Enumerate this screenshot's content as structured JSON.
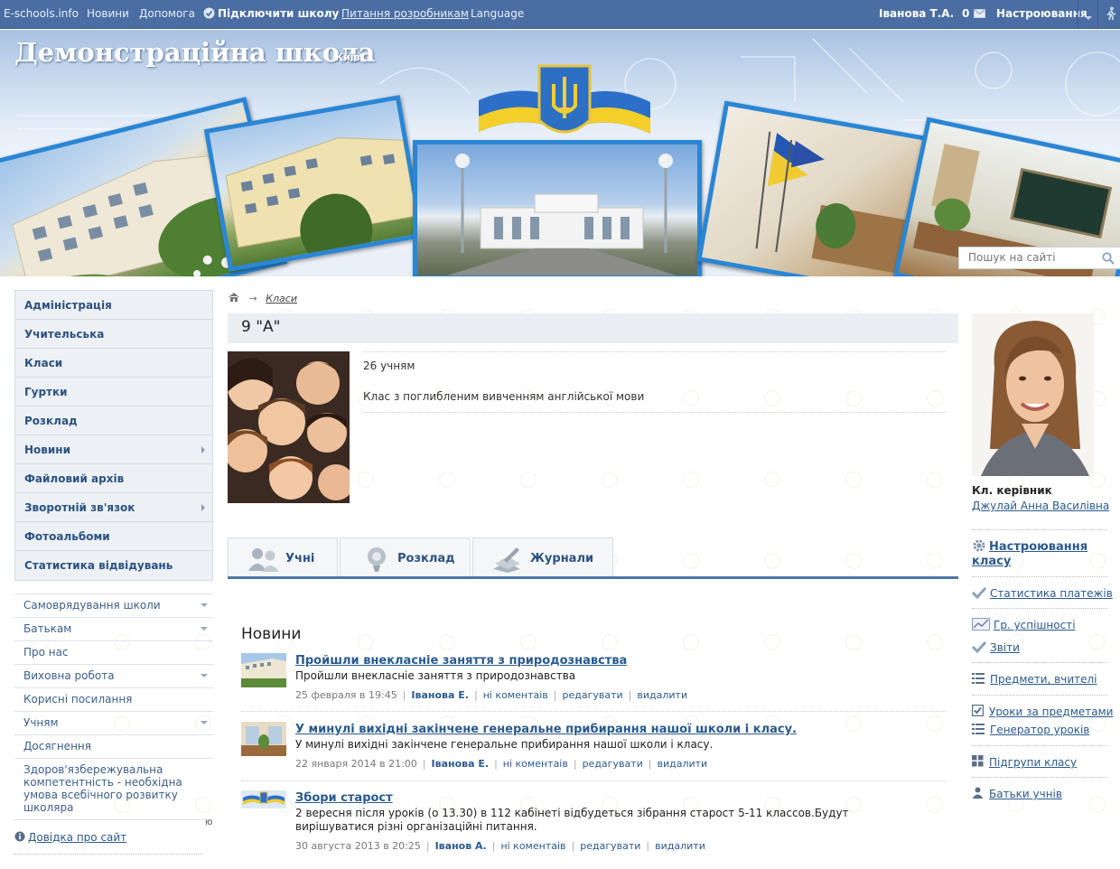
{
  "topbar": {
    "site": "E-schools.info",
    "news": "Новини",
    "help": "Допомога",
    "connect": "Підключити школу",
    "devs": "Питання розробникам",
    "language": "Language",
    "user": "Іванова Т.А.",
    "messages": "0",
    "settings": "Настроювання"
  },
  "banner": {
    "school": "Демонстраційна школа",
    "city": "Київ",
    "search_placeholder": "Пошук на сайті"
  },
  "main_menu": [
    {
      "label": "Адміністрація",
      "arrow": false
    },
    {
      "label": "Учительська",
      "arrow": false
    },
    {
      "label": "Класи",
      "arrow": false
    },
    {
      "label": "Гуртки",
      "arrow": false
    },
    {
      "label": "Розклад",
      "arrow": false
    },
    {
      "label": "Новини",
      "arrow": true
    },
    {
      "label": "Файловий архів",
      "arrow": false
    },
    {
      "label": "Зворотній зв'язок",
      "arrow": true
    },
    {
      "label": "Фотоальбоми",
      "arrow": false
    },
    {
      "label": "Статистика відвідувань",
      "arrow": false
    }
  ],
  "sub_menu": [
    {
      "label": "Самоврядування школи",
      "dropdown": true
    },
    {
      "label": "Батькам",
      "dropdown": true
    },
    {
      "label": "Про нас",
      "dropdown": false
    },
    {
      "label": "Виховна робота",
      "dropdown": true
    },
    {
      "label": "Корисні посилання",
      "dropdown": false
    },
    {
      "label": "Учням",
      "dropdown": true
    },
    {
      "label": "Досягнення",
      "dropdown": false
    },
    {
      "label": "Здоров'язбережувальна компетентність - необхідна умова всебічного розвитку школяра",
      "dropdown": false
    }
  ],
  "side_fragment": "ю",
  "help_link": "Довідка про сайт",
  "breadcrumb": {
    "current": "Класи"
  },
  "class": {
    "name": "9 \"А\"",
    "students": "26 учням",
    "description": "Клас з поглибленим вивченням англійської мови"
  },
  "tabs": [
    {
      "label": "Учні",
      "icon": "users-icon"
    },
    {
      "label": "Розклад",
      "icon": "bell-icon"
    },
    {
      "label": "Журнали",
      "icon": "journal-icon"
    }
  ],
  "news": {
    "heading": "Новини",
    "items": [
      {
        "title": "Пройшли внекласніе заняття з природознавства",
        "text": "Пройшли внекласніе заняття з природознавства",
        "date": "25 февраля в 19:45",
        "author": "Іванова Е.",
        "comments": "ні коментаів",
        "edit": "редагувати",
        "delete": "видалити"
      },
      {
        "title": "У минулі вихідні закінчене генеральне прибирання нашої школи і класу.",
        "text": "У минулі вихідні закінчене генеральне прибирання нашої школи і класу.",
        "date": "22 января 2014 в 21:00",
        "author": "Іванова Е.",
        "comments": "ні коментаів",
        "edit": "редагувати",
        "delete": "видалити"
      },
      {
        "title": "Збори старост",
        "text": "2 вересня після уроків (о 13.30) в 112 кабінеті відбудеться зібрання старост 5-11 классов.Будут вирішуватися різні організаційні питання.",
        "date": "30 августа 2013 в 20:25",
        "author": "Іванов А.",
        "comments": "ні коментаів",
        "edit": "редагувати",
        "delete": "видалити"
      }
    ]
  },
  "teacher": {
    "label": "Кл. керівник",
    "name": "Джулай Анна Василівна"
  },
  "right_links": {
    "settings": "Настроювання класу",
    "payments": "Статистика платежів",
    "success": "Гр. успішності",
    "reports": "Звіти",
    "subjects": "Предмети, вчителі",
    "lessons": "Уроки за предметами",
    "generator": "Генератор уроків",
    "subgroups": "Підгрупи класу",
    "parents": "Батьки учнів"
  },
  "colors": {
    "topbar": "#4a6ea3",
    "accent": "#2a86d4",
    "link": "#2a5a8e",
    "tab_border": "#4b77a8"
  }
}
